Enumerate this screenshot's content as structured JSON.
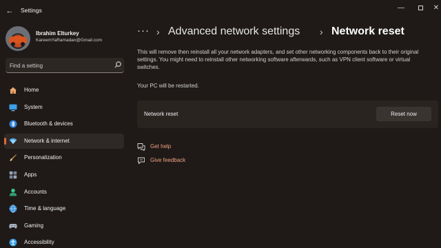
{
  "window": {
    "title": "Settings",
    "back_glyph": "←",
    "minimize_glyph": "—",
    "close_glyph": "✕"
  },
  "user": {
    "name": "Ibrahim Elturkey",
    "email": "KareemYaRamadan@Gmail.com"
  },
  "search": {
    "placeholder": "Find a setting",
    "icon": "search-icon"
  },
  "sidebar": {
    "items": [
      {
        "label": "Home",
        "icon": "home-icon",
        "active": false
      },
      {
        "label": "System",
        "icon": "system-icon",
        "active": false
      },
      {
        "label": "Bluetooth & devices",
        "icon": "bluetooth-icon",
        "active": false
      },
      {
        "label": "Network & internet",
        "icon": "network-icon",
        "active": true
      },
      {
        "label": "Personalization",
        "icon": "brush-icon",
        "active": false
      },
      {
        "label": "Apps",
        "icon": "apps-icon",
        "active": false
      },
      {
        "label": "Accounts",
        "icon": "accounts-icon",
        "active": false
      },
      {
        "label": "Time & language",
        "icon": "globe-icon",
        "active": false
      },
      {
        "label": "Gaming",
        "icon": "gaming-icon",
        "active": false
      },
      {
        "label": "Accessibility",
        "icon": "accessibility-icon",
        "active": false
      }
    ]
  },
  "breadcrumb": {
    "more": "···",
    "separator": "›",
    "parent": "Advanced network settings",
    "current": "Network reset"
  },
  "main": {
    "description": "This will remove then reinstall all your network adapters, and set other networking components back to their original settings. You might need to reinstall other networking software afterwards, such as VPN client software or virtual switches.",
    "restart_note": "Your PC will be restarted.",
    "card": {
      "label": "Network reset",
      "button": "Reset now"
    },
    "links": [
      {
        "label": "Get help",
        "icon": "help-icon"
      },
      {
        "label": "Give feedback",
        "icon": "feedback-icon"
      }
    ]
  },
  "colors": {
    "background": "#1f1a18",
    "accent": "#e06a3a",
    "link": "#f0a080",
    "card": "#2a2421"
  }
}
